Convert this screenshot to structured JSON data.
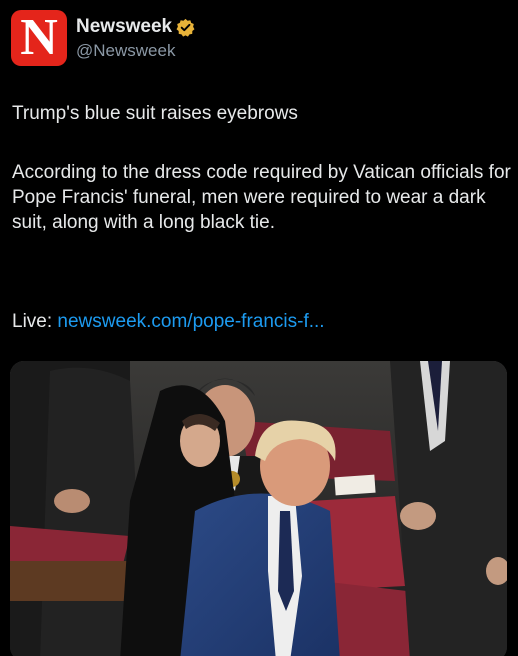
{
  "account": {
    "name": "Newsweek",
    "handle": "@Newsweek",
    "logo_letter": "N",
    "verified_icon": "verified-badge-icon",
    "brand_color": "#e4251b",
    "verified_color": "#e8b339"
  },
  "tweet": {
    "headline": "Trump's blue suit raises eyebrows",
    "body": "According to the dress code required by Vatican officials for Pope Francis' funeral, men were required to wear a dark suit, along with a long black tie.",
    "live_label": "Live:",
    "link_text": "newsweek.com/pope-francis-f..."
  },
  "media": {
    "type": "photo",
    "description_icon": "photo-image"
  },
  "colors": {
    "background": "#000000",
    "text": "#e7e9ea",
    "secondary_text": "#8b98a5",
    "link": "#1d9bf0"
  }
}
